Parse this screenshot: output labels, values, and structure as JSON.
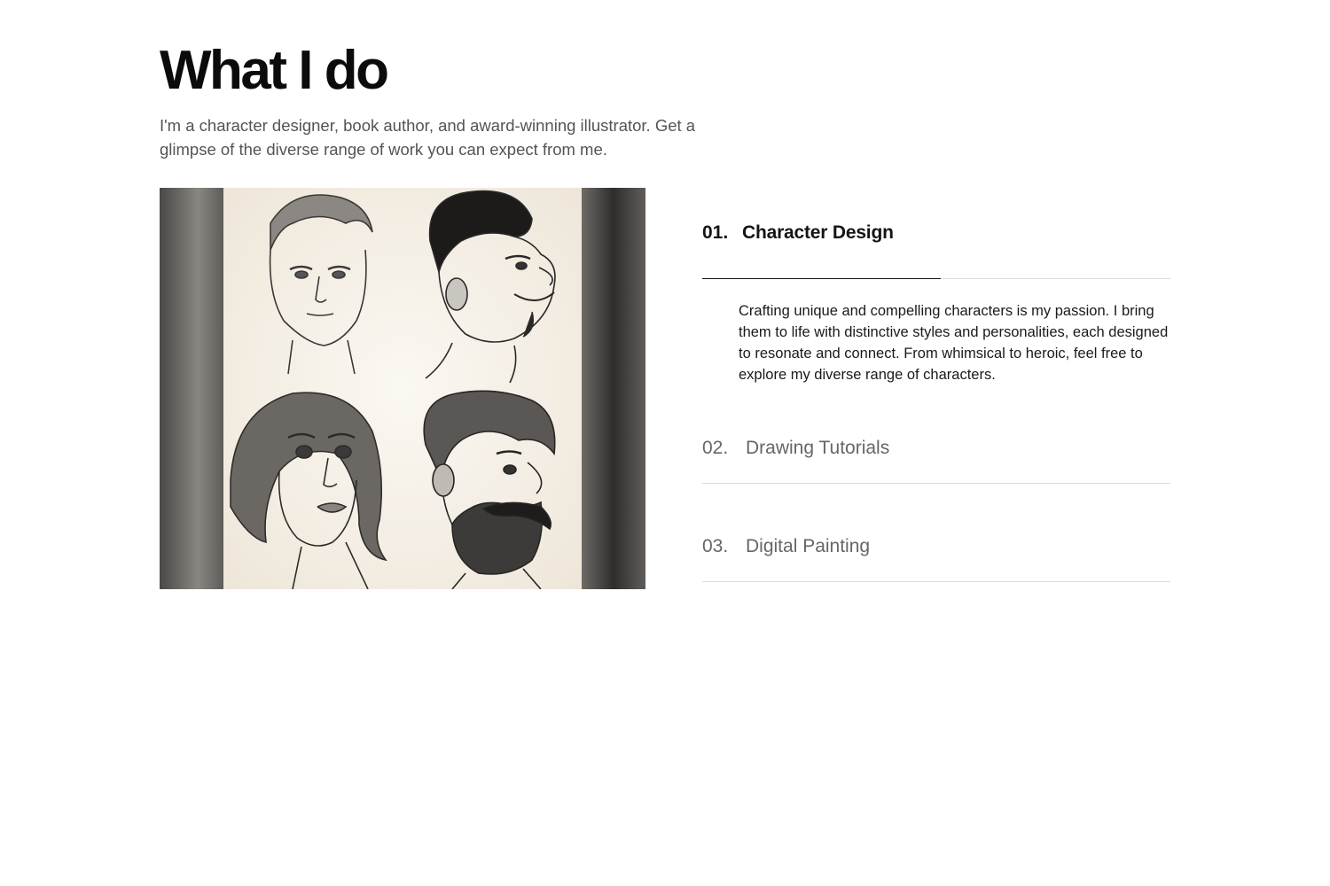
{
  "header": {
    "title": "What I do",
    "subtitle": "I'm a character designer, book author, and award-winning illustrator. Get a glimpse of the diverse range of work you can expect from me."
  },
  "gallery": {
    "image_name": "character-sketches-illustration"
  },
  "services": [
    {
      "number": "01.",
      "label": "Character Design",
      "active": true,
      "description": "Crafting unique and compelling characters is my passion. I bring them to life with distinctive styles and personalities, each designed to resonate and connect. From whimsical to heroic, feel free to explore my diverse range of characters."
    },
    {
      "number": "02.",
      "label": "Drawing Tutorials",
      "active": false
    },
    {
      "number": "03.",
      "label": "Digital Painting",
      "active": false
    }
  ],
  "colors": {
    "text_primary": "#111111",
    "text_muted": "#666666",
    "rule": "#dcdcdc",
    "paper": "#f7f2ea"
  }
}
